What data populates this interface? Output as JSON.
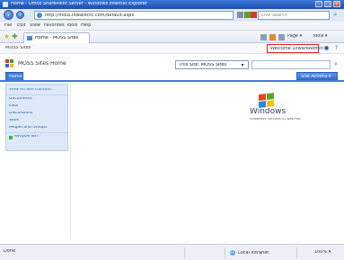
{
  "window": {
    "title": "Home - Office SharePoint Server - Windows Internet Explorer",
    "minimize": "–",
    "maximize": "□",
    "close": "×"
  },
  "browser": {
    "back": "‹",
    "forward": "›",
    "url": "http://moss.litwareinc.com/default.aspx",
    "search_placeholder": "Live Search",
    "search_go": "⌕",
    "menu": [
      "File",
      "Edit",
      "View",
      "Favorites",
      "Tools",
      "Help"
    ],
    "tab_title": "Home - MOSS Sites",
    "commands": [
      "Page ▾",
      "Tools ▾"
    ]
  },
  "sharepoint": {
    "top_crumb": "MOSS Sites",
    "welcome": "Welcome LitwareAdmin ▾",
    "help_icon": "?",
    "site_title": "MOSS Sites Home",
    "search_scope": "This Site: MOSS Sites",
    "search_go": "⌕",
    "home_tab": "Home",
    "site_actions": "Site Actions ▾",
    "quick_launch": {
      "heading": "View All Site Content",
      "items": [
        "Documents",
        "Lists",
        "Discussions",
        "Sites",
        "People and Groups"
      ],
      "recycle_bin": "Recycle Bin"
    }
  },
  "logo": {
    "word": "Windows",
    "tagline": "SharePoint Services v3 Web Part"
  },
  "status": {
    "text": "Done",
    "zone": "Local intranet",
    "zoom": "100% ▾"
  }
}
